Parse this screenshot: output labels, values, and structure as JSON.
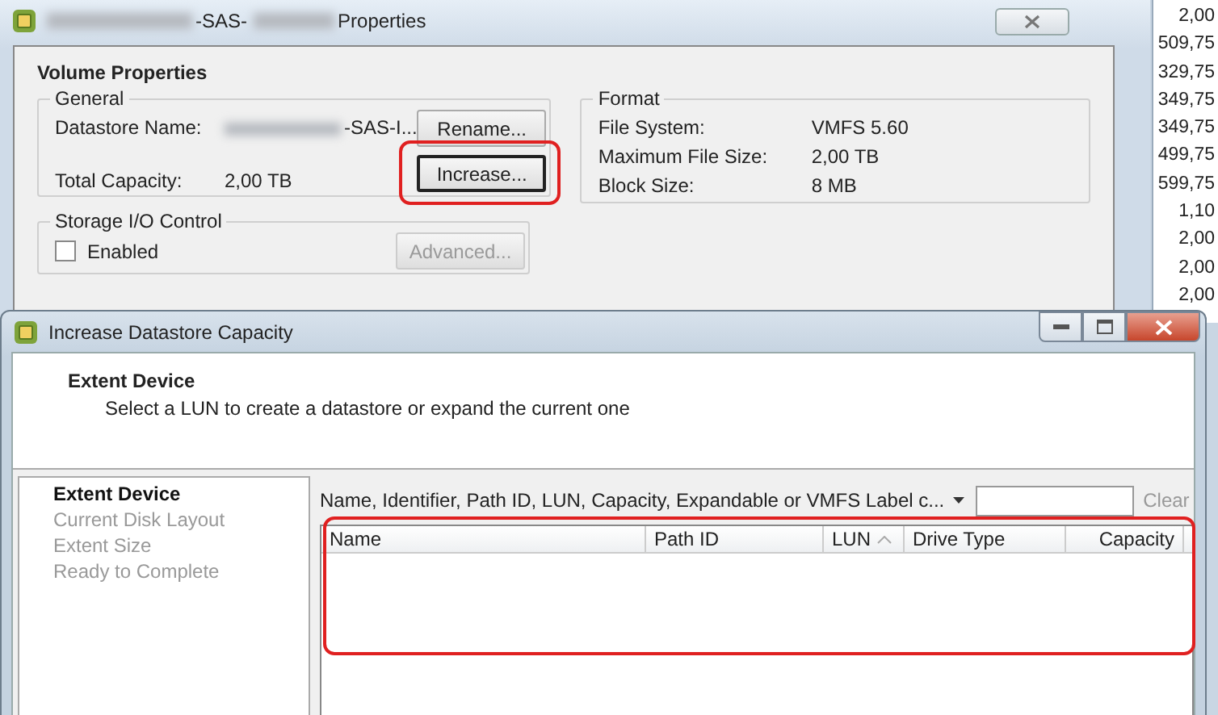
{
  "back_window": {
    "title_parts": [
      "-SAS-",
      "Properties"
    ],
    "section_title": "Volume Properties",
    "general": {
      "legend": "General",
      "rows": [
        {
          "label": "Datastore Name:",
          "value": "-SAS-I..."
        },
        {
          "label": "Total Capacity:",
          "value": "2,00 TB"
        }
      ],
      "buttons": [
        {
          "label": "Rename...",
          "highlighted": false
        },
        {
          "label": "Increase...",
          "highlighted": true
        }
      ]
    },
    "format": {
      "legend": "Format",
      "rows": [
        {
          "label": "File System:",
          "value": "VMFS 5.60"
        },
        {
          "label": "Maximum File Size:",
          "value": "2,00 TB"
        },
        {
          "label": "Block Size:",
          "value": "8 MB"
        }
      ]
    },
    "storage_io": {
      "legend": "Storage I/O Control",
      "checkbox": {
        "label": "Enabled",
        "checked": false
      },
      "button": {
        "label": "Advanced...",
        "disabled": true
      }
    }
  },
  "side_column": [
    "2,00",
    "509,75",
    "329,75",
    "349,75",
    "349,75",
    "499,75",
    "599,75",
    "1,10",
    "2,00",
    "2,00",
    "2,00"
  ],
  "front_window": {
    "title": "Increase Datastore Capacity",
    "header": {
      "title": "Extent Device",
      "subtitle": "Select a LUN to create a datastore or expand the current one"
    },
    "steps": [
      {
        "label": "Extent Device",
        "selected": true
      },
      {
        "label": "Current Disk Layout",
        "selected": false
      },
      {
        "label": "Extent Size",
        "selected": false
      },
      {
        "label": "Ready to Complete",
        "selected": false
      }
    ],
    "filter": {
      "label": "Name, Identifier, Path ID, LUN, Capacity, Expandable or VMFS Label c...",
      "clear": "Clear"
    },
    "table": {
      "highlighted": true,
      "columns": [
        {
          "label": "Name",
          "sorted": false
        },
        {
          "label": "Path ID",
          "sorted": false
        },
        {
          "label": "LUN",
          "sorted": true
        },
        {
          "label": "Drive Type",
          "sorted": false
        },
        {
          "label": "Capacity",
          "sorted": false
        }
      ]
    }
  }
}
